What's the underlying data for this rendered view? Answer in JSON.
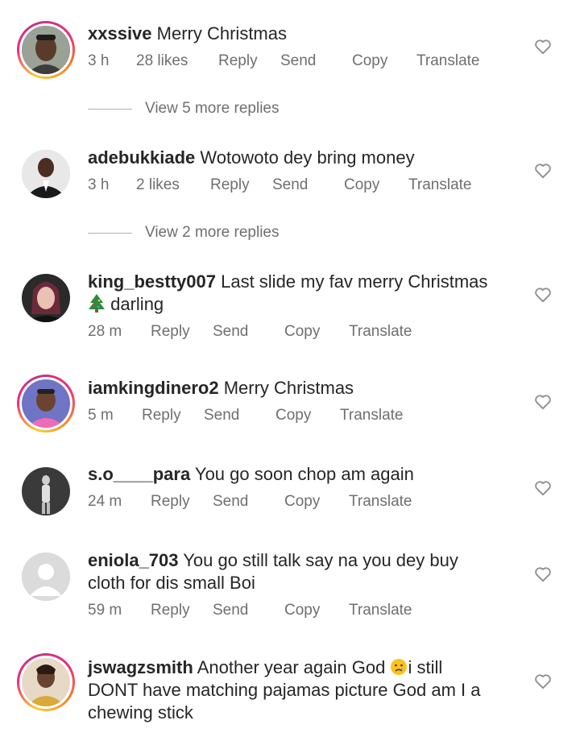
{
  "comments": [
    {
      "username": "xxssive",
      "text": "Merry Christmas",
      "time": "3 h",
      "likes": "28 likes",
      "reply": "Reply",
      "send": "Send",
      "copy": "Copy",
      "translate": "Translate",
      "avatar_icon": "user-photo-man",
      "ring": true
    },
    {
      "username": "adebukkiade",
      "text": "Wotowoto dey bring money",
      "time": "3 h",
      "likes": "2 likes",
      "reply": "Reply",
      "send": "Send",
      "copy": "Copy",
      "translate": "Translate",
      "avatar_icon": "user-photo-suit",
      "ring": false
    },
    {
      "username": "king_bestty007",
      "text": "Last slide my fav merry Christmas",
      "text2": "darling",
      "emoji": "christmas-tree-icon",
      "time": "28 m",
      "reply": "Reply",
      "send": "Send",
      "copy": "Copy",
      "translate": "Translate",
      "avatar_icon": "user-photo-woman",
      "ring": false
    },
    {
      "username": "iamkingdinero2",
      "text": "Merry Christmas",
      "time": "5 m",
      "reply": "Reply",
      "send": "Send",
      "copy": "Copy",
      "translate": "Translate",
      "avatar_icon": "user-photo-pink",
      "ring": true
    },
    {
      "username": "s.o____para",
      "text": "You go soon chop am again",
      "time": "24 m",
      "reply": "Reply",
      "send": "Send",
      "copy": "Copy",
      "translate": "Translate",
      "avatar_icon": "user-photo-dark",
      "ring": false
    },
    {
      "username": "eniola_703",
      "text": "You go still talk say na you dey buy",
      "text2": "cloth for dis small Boi",
      "time": "59 m",
      "reply": "Reply",
      "send": "Send",
      "copy": "Copy",
      "translate": "Translate",
      "avatar_icon": "default-avatar-icon",
      "ring": false
    },
    {
      "username": "jswagzsmith",
      "text": "Another year again God",
      "emoji": "crying-face-icon",
      "text_after_emoji": "i still",
      "text2": "DONT have matching pajamas picture God am I a",
      "text3": "chewing stick",
      "avatar_icon": "user-photo-woman-gold",
      "ring": true
    }
  ],
  "view_more": [
    {
      "label": "View 5 more replies"
    },
    {
      "label": "View 2 more replies"
    }
  ],
  "colors": {
    "text": "#262626",
    "meta": "#6f6f6f",
    "ring_start": "#f9ce34",
    "ring_end": "#ee2a7b"
  }
}
